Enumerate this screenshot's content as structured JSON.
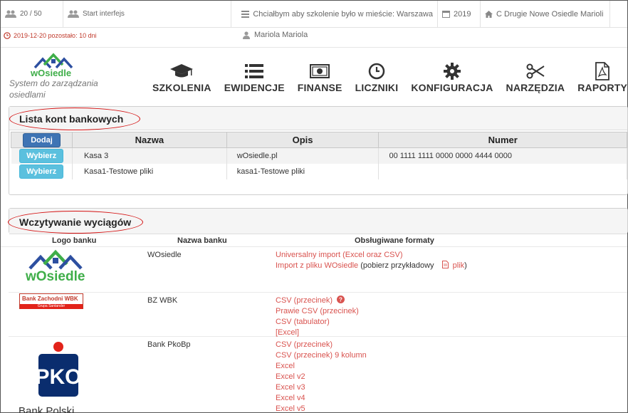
{
  "topbar": {
    "counter": "20 / 50",
    "start_link": "Start interfejs",
    "training_city": "Chciałbym aby szkolenie było w mieście: Warszawa",
    "year": "2019",
    "estate": "C Drugie Nowe Osiedle Marioli",
    "expiry": "2019-12-20 pozostało: 10 dni",
    "user": "Mariola Mariola"
  },
  "brand": {
    "logo_text": "wOsiedle",
    "tagline": "System do zarządzania osiedlami",
    "colors": {
      "blue": "#2d4fa0",
      "green": "#3fae49",
      "red": "#d9534f"
    }
  },
  "nav": {
    "items": [
      {
        "label": "SZKOLENIA",
        "icon": "graduation-cap-icon"
      },
      {
        "label": "EWIDENCJE",
        "icon": "list-icon"
      },
      {
        "label": "FINANSE",
        "icon": "money-icon"
      },
      {
        "label": "LICZNIKI",
        "icon": "clock-icon"
      },
      {
        "label": "KONFIGURACJA",
        "icon": "gear-icon"
      },
      {
        "label": "NARZĘDZIA",
        "icon": "scissors-icon"
      },
      {
        "label": "RAPORTY",
        "icon": "pdf-icon"
      }
    ]
  },
  "accounts": {
    "title": "Lista kont bankowych",
    "add_label": "Dodaj",
    "select_label": "Wybierz",
    "columns": [
      "Nazwa",
      "Opis",
      "Numer"
    ],
    "rows": [
      {
        "name": "Kasa 3",
        "desc": "wOsiedle.pl",
        "number": "00 1111 1111 0000 0000 4444 0000"
      },
      {
        "name": "Kasa1-Testowe pliki",
        "desc": "kasa1-Testowe pliki",
        "number": ""
      }
    ]
  },
  "statements": {
    "title": "Wczytywanie wyciągów",
    "columns": [
      "Logo banku",
      "Nazwa banku",
      "Obsługiwane formaty"
    ],
    "banks": [
      {
        "name": "WOsiedle",
        "logo_text": "wOsiedle",
        "formats": [
          "Universalny import (Excel oraz CSV)"
        ],
        "import_line": {
          "link": "Import z pliku WOsiedle",
          "note": "(pobierz przykładowy",
          "file_link": "plik",
          "close": ")"
        }
      },
      {
        "name": "BZ WBK",
        "logo_text": "Bank Zachodni WBK",
        "logo_subtext": "Grupa Santander",
        "formats": [
          "CSV (przecinek)",
          "Prawie CSV (przecinek)",
          "CSV (tabulator)",
          "[Excel]"
        ]
      },
      {
        "name": "Bank PkoBp",
        "logo_text": "Bank Polski",
        "formats": [
          "CSV (przecinek)",
          "CSV (przecinek) 9 kolumn",
          "Excel",
          "Excel v2",
          "Excel v3",
          "Excel v4",
          "Excel v5"
        ]
      }
    ]
  }
}
